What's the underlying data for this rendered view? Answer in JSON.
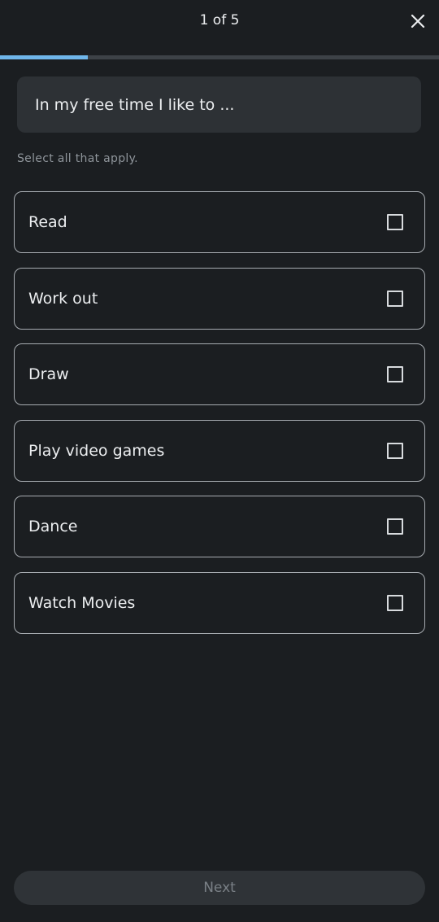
{
  "header": {
    "step_counter": "1 of 5",
    "close_icon": "close-icon",
    "progress": {
      "current": 1,
      "total": 5,
      "fraction": 0.2,
      "fill_color": "#6fb6ea",
      "track_color": "#3d4247"
    }
  },
  "question": {
    "text": "In my free time I like to ..."
  },
  "hint": "Select all that apply.",
  "options": [
    {
      "label": "Read",
      "checked": false
    },
    {
      "label": "Work out",
      "checked": false
    },
    {
      "label": "Draw",
      "checked": false
    },
    {
      "label": "Play video games",
      "checked": false
    },
    {
      "label": "Dance",
      "checked": false
    },
    {
      "label": "Watch Movies",
      "checked": false
    }
  ],
  "footer": {
    "next_label": "Next",
    "next_enabled": false
  },
  "colors": {
    "background": "#1b1e21",
    "accent": "#6fb6ea"
  }
}
